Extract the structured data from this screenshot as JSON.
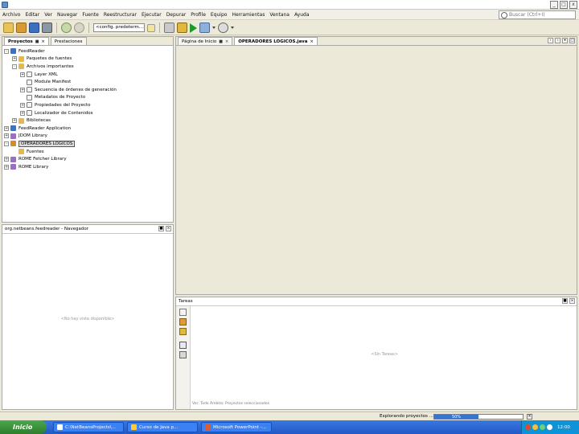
{
  "window": {
    "min": "_",
    "max": "□",
    "close": "x"
  },
  "menu": [
    "Archivo",
    "Editar",
    "Ver",
    "Navegar",
    "Fuente",
    "Reestructurar",
    "Ejecutar",
    "Depurar",
    "Profile",
    "Equipo",
    "Herramientas",
    "Ventana",
    "Ayuda"
  ],
  "search": {
    "placeholder": "Buscar (Ctrl+I)"
  },
  "toolbar": {
    "config_value": "<config. predeterm...>"
  },
  "projects_panel": {
    "tabs": [
      {
        "label": "Proyectos",
        "active": true
      },
      {
        "label": "Prestaciones",
        "active": false
      }
    ],
    "tree": [
      {
        "depth": 0,
        "toggle": "-",
        "icon": "proj",
        "label": "FeedReader"
      },
      {
        "depth": 1,
        "toggle": "+",
        "icon": "folder",
        "label": "Paquetes de fuentes"
      },
      {
        "depth": 1,
        "toggle": "-",
        "icon": "folder",
        "label": "Archivos importantes"
      },
      {
        "depth": 2,
        "toggle": "+",
        "icon": "file",
        "label": "Layer XML"
      },
      {
        "depth": 2,
        "toggle": "",
        "icon": "file",
        "label": "Module Manifest"
      },
      {
        "depth": 2,
        "toggle": "+",
        "icon": "file",
        "label": "Secuencia de órdenes de generación"
      },
      {
        "depth": 2,
        "toggle": "",
        "icon": "file",
        "label": "Metadatos de Proyecto"
      },
      {
        "depth": 2,
        "toggle": "+",
        "icon": "file",
        "label": "Propiedades del Proyecto"
      },
      {
        "depth": 2,
        "toggle": "+",
        "icon": "file",
        "label": "Localizador de Contenidos"
      },
      {
        "depth": 1,
        "toggle": "+",
        "icon": "folder",
        "label": "Bibliotecas"
      },
      {
        "depth": 0,
        "toggle": "+",
        "icon": "proj",
        "label": "FeedReader Application"
      },
      {
        "depth": 0,
        "toggle": "+",
        "icon": "lib",
        "label": "JDOM Library"
      },
      {
        "depth": 0,
        "toggle": "-",
        "icon": "cup",
        "label": "OPERADORES LOGICOS",
        "selected": true
      },
      {
        "depth": 1,
        "toggle": "",
        "icon": "folder",
        "label": "Fuentes"
      },
      {
        "depth": 0,
        "toggle": "+",
        "icon": "lib",
        "label": "ROME Fetcher Library"
      },
      {
        "depth": 0,
        "toggle": "+",
        "icon": "lib",
        "label": "ROME Library"
      }
    ]
  },
  "navigator": {
    "title": "org.netbeans.feedreader - Navegador",
    "empty": "<No hay vista disponible>"
  },
  "editor": {
    "tabs": [
      {
        "label": "Página de Inicio",
        "active": false
      },
      {
        "label": "OPERADORES LOGICOS.java",
        "active": true
      }
    ]
  },
  "tasks": {
    "title": "Tareas",
    "empty": "<Sin Tareas>",
    "filter_text": "Ver: Todo   Ámbito: Proyectos seleccionados"
  },
  "status": {
    "task": "Explorando proyectos ...",
    "progress_label": "50%",
    "progress": 0.5
  },
  "taskbar": {
    "start": "Inicio",
    "items": [
      "C:\\NetBeansProjects\\...",
      "Curso de Java p...",
      "Microsoft PowerPoint -..."
    ],
    "clock": "12:00"
  }
}
